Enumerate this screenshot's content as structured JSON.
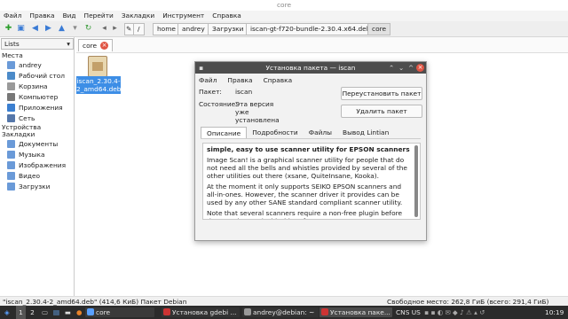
{
  "window": {
    "title": "core"
  },
  "menubar": [
    "Файл",
    "Правка",
    "Вид",
    "Перейти",
    "Закладки",
    "Инструмент",
    "Справка"
  ],
  "breadcrumb": [
    "home",
    "andrey",
    "Загрузки",
    "iscan-gt-f720-bundle-2.30.4.x64.deb",
    "core"
  ],
  "path_root": "/",
  "tab": {
    "label": "core"
  },
  "sidebar": {
    "select": "Lists",
    "places_header": "Места",
    "places": [
      "andrey",
      "Рабочий стол",
      "Корзина",
      "Компьютер",
      "Приложения",
      "Сеть"
    ],
    "devices_header": "Устройства",
    "bookmarks_header": "Закладки",
    "bookmarks": [
      "Документы",
      "Музыка",
      "Изображения",
      "Видео",
      "Загрузки"
    ]
  },
  "file": {
    "name": "iscan_2.30.4-2_amd64.deb"
  },
  "statusbar": {
    "left": "\"iscan_2.30.4-2_amd64.deb\" (414,6 КиБ) Пакет Debian",
    "right": "Свободное место: 262,8 ГиБ (всего: 291,4 ГиБ)"
  },
  "dialog": {
    "title": "Установка пакета — iscan",
    "menu": [
      "Файл",
      "Правка",
      "Справка"
    ],
    "package_label": "Пакет:",
    "package_value": "iscan",
    "state_label": "Состояние:",
    "state_value": "Эта версия уже установлена",
    "reinstall_button": "Переустановить пакет",
    "remove_button": "Удалить пакет",
    "tabs": [
      "Описание",
      "Подробности",
      "Файлы",
      "Вывод Lintian"
    ],
    "description": {
      "heading": "simple, easy to use scanner utility for EPSON scanners",
      "p1": "Image Scan! is a graphical scanner utility for people that do not need all the bells and whistles provided by several of the other utilities out there (xsane, QuiteInsane, Kooka).",
      "p2": "At the moment it only supports SEIKO EPSON scanners and all-in-ones. However, the scanner driver it provides can be used by any other SANE standard compliant scanner utility.",
      "p3": "Note that several scanners require a non-free plugin before they can be used with this software."
    }
  },
  "taskbar": {
    "desktops": [
      "1",
      "2"
    ],
    "apps": [
      "core",
      "Установка gdebi ...",
      "andrey@debian: ~",
      "Установка паке..."
    ],
    "lang": "CNS US",
    "time": "10:19"
  },
  "colors": {
    "selection": "#3d8ee6",
    "dialog_title": "#4d4d4d",
    "taskbar": "#2b2b2b",
    "close": "#e05544"
  }
}
